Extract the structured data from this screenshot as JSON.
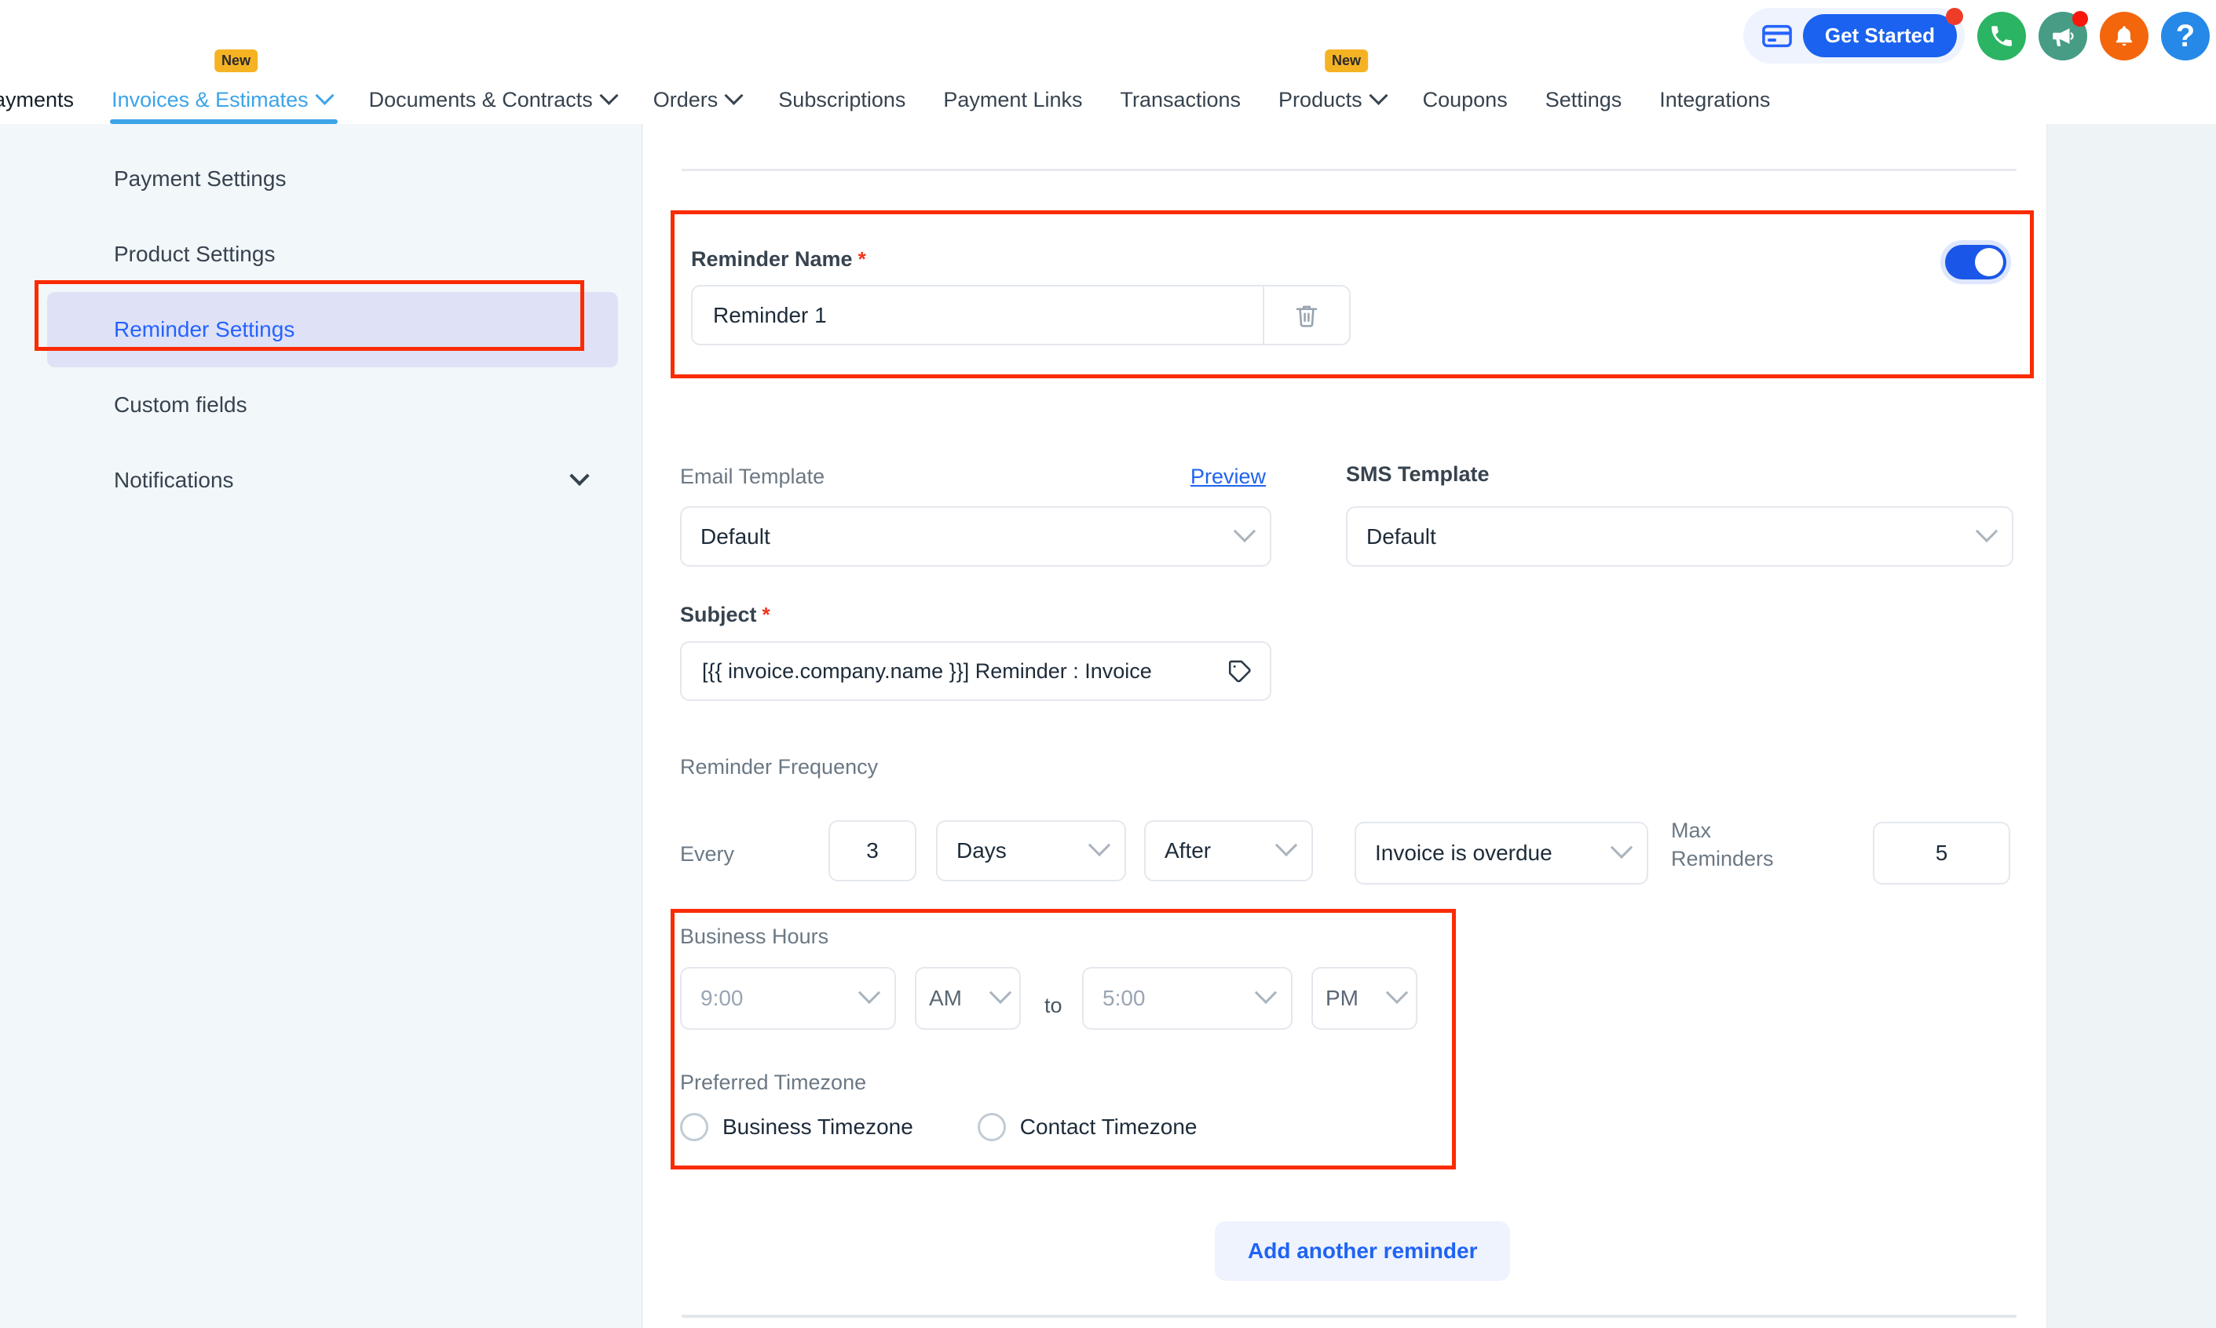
{
  "topbar": {
    "get_started": {
      "label": "Get Started",
      "card_icon": "credit-card-icon",
      "has_notification_dot": true
    },
    "icons": [
      {
        "name": "phone-icon",
        "color": "#2bb463",
        "badge": false
      },
      {
        "name": "megaphone-icon",
        "color": "#479c86",
        "badge": true
      },
      {
        "name": "bell-icon",
        "color": "#f4660c",
        "badge": false
      },
      {
        "name": "help-icon",
        "color": "#2689e8",
        "badge": false,
        "glyph": "?"
      }
    ]
  },
  "nav": {
    "brand": "Payments",
    "items": [
      {
        "label": "Invoices & Estimates",
        "has_chevron": true,
        "badge": "New",
        "active": true
      },
      {
        "label": "Documents & Contracts",
        "has_chevron": true,
        "badge": null,
        "active": false
      },
      {
        "label": "Orders",
        "has_chevron": true,
        "badge": null,
        "active": false
      },
      {
        "label": "Subscriptions",
        "has_chevron": false,
        "badge": null,
        "active": false
      },
      {
        "label": "Payment Links",
        "has_chevron": false,
        "badge": null,
        "active": false
      },
      {
        "label": "Transactions",
        "has_chevron": false,
        "badge": null,
        "active": false
      },
      {
        "label": "Products",
        "has_chevron": true,
        "badge": "New",
        "active": false
      },
      {
        "label": "Coupons",
        "has_chevron": false,
        "badge": null,
        "active": false
      },
      {
        "label": "Settings",
        "has_chevron": false,
        "badge": null,
        "active": false
      },
      {
        "label": "Integrations",
        "has_chevron": false,
        "badge": null,
        "active": false
      }
    ]
  },
  "sidebar": {
    "items": [
      {
        "label": "Payment Settings",
        "selected": false,
        "expandable": false
      },
      {
        "label": "Product Settings",
        "selected": false,
        "expandable": false
      },
      {
        "label": "Reminder Settings",
        "selected": true,
        "expandable": false
      },
      {
        "label": "Custom fields",
        "selected": false,
        "expandable": false
      },
      {
        "label": "Notifications",
        "selected": false,
        "expandable": true
      }
    ]
  },
  "reminder": {
    "name_label": "Reminder Name",
    "name_required": "*",
    "name_value": "Reminder 1",
    "delete_icon": "trash-icon",
    "enabled": true,
    "email_template_label": "Email Template",
    "preview_label": "Preview",
    "email_template_value": "Default",
    "sms_template_label": "SMS Template",
    "sms_template_value": "Default",
    "subject_label": "Subject",
    "subject_required": "*",
    "subject_value": "[{{ invoice.company.name }}] Reminder : Invoice",
    "subject_tag_icon": "tag-icon",
    "frequency_title": "Reminder Frequency",
    "every_label": "Every",
    "interval_value": "3",
    "unit_value": "Days",
    "relation_value": "After",
    "condition_value": "Invoice is overdue",
    "max_reminders_label": "Max Reminders",
    "max_reminders_value": "5",
    "business_hours_label": "Business Hours",
    "hours_from": "9:00",
    "hours_from_meridiem": "AM",
    "hours_to_label": "to",
    "hours_to": "5:00",
    "hours_to_meridiem": "PM",
    "timezone_label": "Preferred Timezone",
    "timezone_options": [
      {
        "label": "Business Timezone",
        "checked": false
      },
      {
        "label": "Contact Timezone",
        "checked": false
      }
    ],
    "add_button_label": "Add another reminder"
  },
  "colors": {
    "accent_blue": "#2563ff",
    "nav_active": "#3ca4e8",
    "primary_button": "#1a62ef",
    "highlight_red": "#fa2b00",
    "badge_yellow": "#f5b324",
    "toggle_on": "#1a56e8"
  }
}
